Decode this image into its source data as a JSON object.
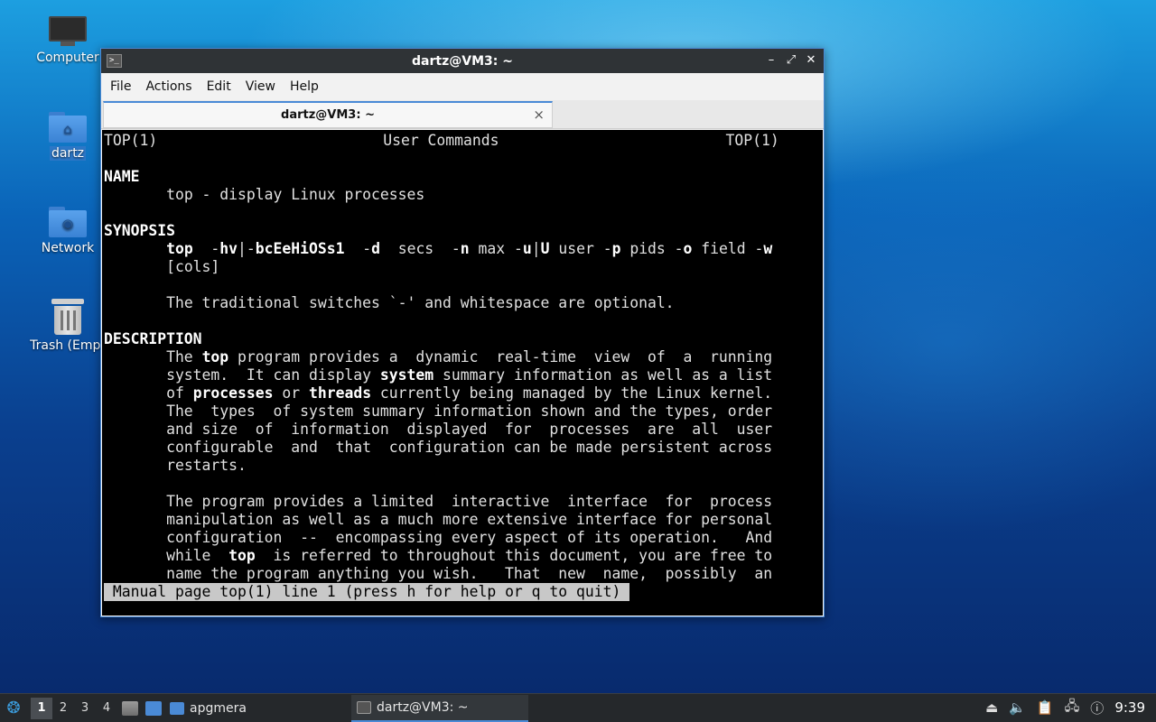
{
  "desktop": {
    "icons": [
      {
        "label": "Computer"
      },
      {
        "label": "dartz"
      },
      {
        "label": "Network"
      },
      {
        "label": "Trash (Empt"
      }
    ]
  },
  "window": {
    "title": "dartz@VM3: ~",
    "menu": [
      "File",
      "Actions",
      "Edit",
      "View",
      "Help"
    ],
    "tab_title": "dartz@VM3: ~",
    "tab_close": "×"
  },
  "terminal": {
    "header_left": "TOP(1)",
    "header_center": "User Commands",
    "header_right": "TOP(1)",
    "section_name": "NAME",
    "name_line": "top - display Linux processes",
    "section_synopsis": "SYNOPSIS",
    "synopsis_wrap": "[cols]",
    "synopsis_note": "The traditional switches `-' and whitespace are optional.",
    "section_description": "DESCRIPTION",
    "desc_lines": [
      "and size  of  information  displayed  for  processes  are  all  user",
      "configurable  and  that  configuration can be made persistent across",
      "restarts."
    ],
    "desc2_lines": [
      "The program provides a limited  interactive  interface  for  process",
      "manipulation as well as a much more extensive interface for personal",
      "configuration  --  encompassing every aspect of its operation.   And"
    ],
    "desc2_last": "name the program anything you wish.   That  new  name,  possibly  an",
    "status_line": "Manual page top(1) line 1 (press h for help or q to quit)"
  },
  "taskbar": {
    "workspaces": [
      "1",
      "2",
      "3",
      "4"
    ],
    "tasks": [
      {
        "label": "apgmera"
      },
      {
        "label": "dartz@VM3: ~"
      }
    ],
    "clock": "9:39"
  }
}
